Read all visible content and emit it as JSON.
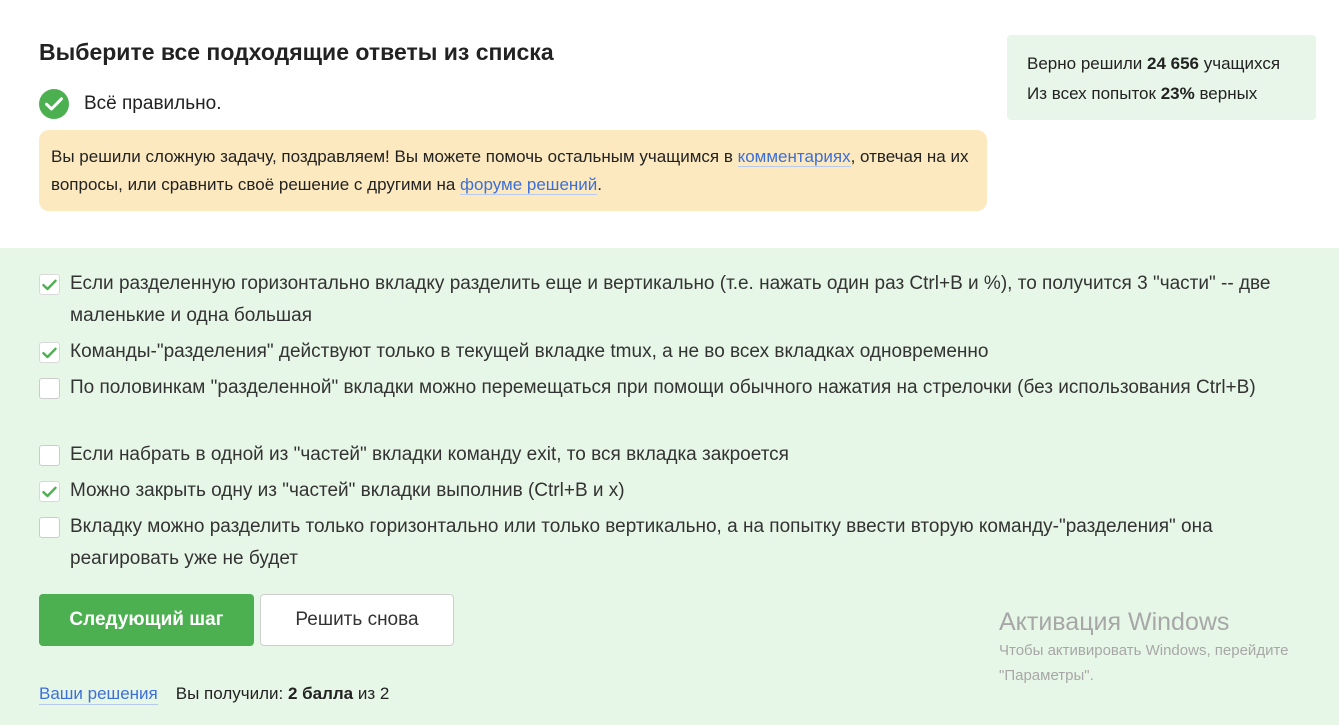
{
  "header": {
    "title": "Выберите все подходящие ответы из списка",
    "verdict": "Всё правильно."
  },
  "notice": {
    "text_before": "Вы решили сложную задачу, поздравляем! Вы можете помочь остальным учащимся в ",
    "comments_link": "комментариях",
    "text_middle": ", отвечая на их вопросы, или сравнить своё решение с другими на ",
    "forum_link": "форуме решений",
    "text_after": "."
  },
  "stats": {
    "solved_prefix": "Верно решили ",
    "solved_count": "24 656",
    "solved_suffix": " учащихся",
    "attempts_prefix": "Из всех попыток ",
    "attempts_percent": "23%",
    "attempts_suffix": " верных"
  },
  "options": [
    {
      "text": "Если разделенную горизонтально вкладку разделить еще и вертикально (т.е. нажать один раз Ctrl+B и %), то получится 3 \"части\" -- две маленькие и одна большая",
      "checked": true
    },
    {
      "text": "Команды-\"разделения\" действуют только в текущей вкладке tmux, а не во всех вкладках одновременно",
      "checked": true
    },
    {
      "text": "По половинкам \"разделенной\" вкладки можно перемещаться при помощи обычного нажатия на стрелочки (без использования Ctrl+B)",
      "checked": false
    },
    {
      "text": "Если набрать в одной из \"частей\" вкладки команду exit, то вся вкладка закроется",
      "checked": false
    },
    {
      "text": "Можно закрыть одну из \"частей\" вкладки выполнив (Ctrl+B и x)",
      "checked": true
    },
    {
      "text": "Вкладку можно разделить только горизонтально или только вертикально, а на попытку ввести вторую команду-\"разделения\" она реагировать уже не будет",
      "checked": false
    }
  ],
  "buttons": {
    "next": "Следующий шаг",
    "retry": "Решить снова"
  },
  "footer": {
    "solutions_link": "Ваши решения",
    "score_prefix": "Вы получили: ",
    "score_value": "2 балла",
    "score_suffix": " из 2"
  },
  "watermark": {
    "title": "Активация Windows",
    "line1": "Чтобы активировать Windows, перейдите",
    "line2": "\"Параметры\"."
  },
  "colors": {
    "accent_green": "#4caf50",
    "link_blue": "#3c6fd8",
    "notice_bg": "#fde9bf",
    "quiz_bg": "#e7f7e7"
  }
}
